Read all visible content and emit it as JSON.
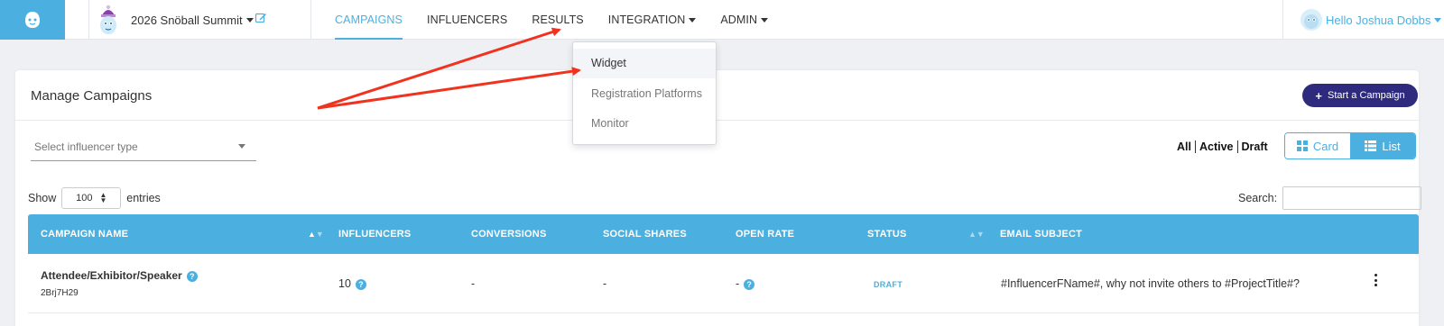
{
  "header": {
    "project_name": "2026 Snöball Summit",
    "nav": [
      {
        "label": "CAMPAIGNS",
        "active": true
      },
      {
        "label": "INFLUENCERS",
        "active": false
      },
      {
        "label": "RESULTS",
        "active": false
      },
      {
        "label": "INTEGRATION",
        "active": false,
        "dropdown": true
      },
      {
        "label": "ADMIN",
        "active": false,
        "dropdown": true
      }
    ],
    "greeting": "Hello Joshua Dobbs"
  },
  "integration_menu": {
    "items": [
      "Widget",
      "Registration Platforms",
      "Monitor"
    ],
    "highlighted": "Widget"
  },
  "card": {
    "title": "Manage Campaigns",
    "start_button": "Start a Campaign",
    "influencer_select_placeholder": "Select influencer type",
    "filters": [
      "All",
      "Active",
      "Draft"
    ],
    "view_card": "Card",
    "view_list": "List",
    "show_label": "Show",
    "show_value": "100",
    "entries_label": "entries",
    "search_label": "Search:"
  },
  "table": {
    "columns": [
      "CAMPAIGN NAME",
      "INFLUENCERS",
      "CONVERSIONS",
      "SOCIAL SHARES",
      "OPEN RATE",
      "STATUS",
      "EMAIL SUBJECT"
    ],
    "rows": [
      {
        "name": "Attendee/Exhibitor/Speaker",
        "code": "2Brj7H29",
        "influencers": "10",
        "conversions": "-",
        "social_shares": "-",
        "open_rate": "-",
        "status": "DRAFT",
        "email_subject": "#InfluencerFName#, why not invite others to #ProjectTitle#?"
      }
    ]
  },
  "colors": {
    "accent": "#4bb0e0",
    "primary_button": "#2e2a7e",
    "annotation_arrow": "#f0321e"
  }
}
